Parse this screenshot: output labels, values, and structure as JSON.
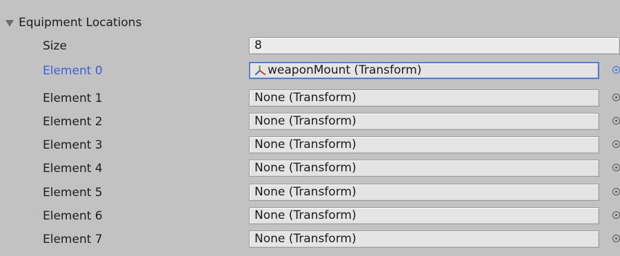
{
  "foldout": {
    "label": "Equipment Locations"
  },
  "size": {
    "label": "Size",
    "value": "8"
  },
  "elements": [
    {
      "label": "Element 0",
      "value": "weaponMount (Transform)",
      "selected": true,
      "icon": "transform-icon"
    },
    {
      "label": "Element 1",
      "value": "None (Transform)"
    },
    {
      "label": "Element 2",
      "value": "None (Transform)"
    },
    {
      "label": "Element 3",
      "value": "None (Transform)"
    },
    {
      "label": "Element 4",
      "value": "None (Transform)"
    },
    {
      "label": "Element 5",
      "value": "None (Transform)"
    },
    {
      "label": "Element 6",
      "value": "None (Transform)"
    },
    {
      "label": "Element 7",
      "value": "None (Transform)"
    }
  ],
  "colors": {
    "background": "#c2c2c2",
    "selected_label": "#3d5fd6",
    "focus_border": "#4a7ee0",
    "field_background": "#e4e4e4"
  }
}
